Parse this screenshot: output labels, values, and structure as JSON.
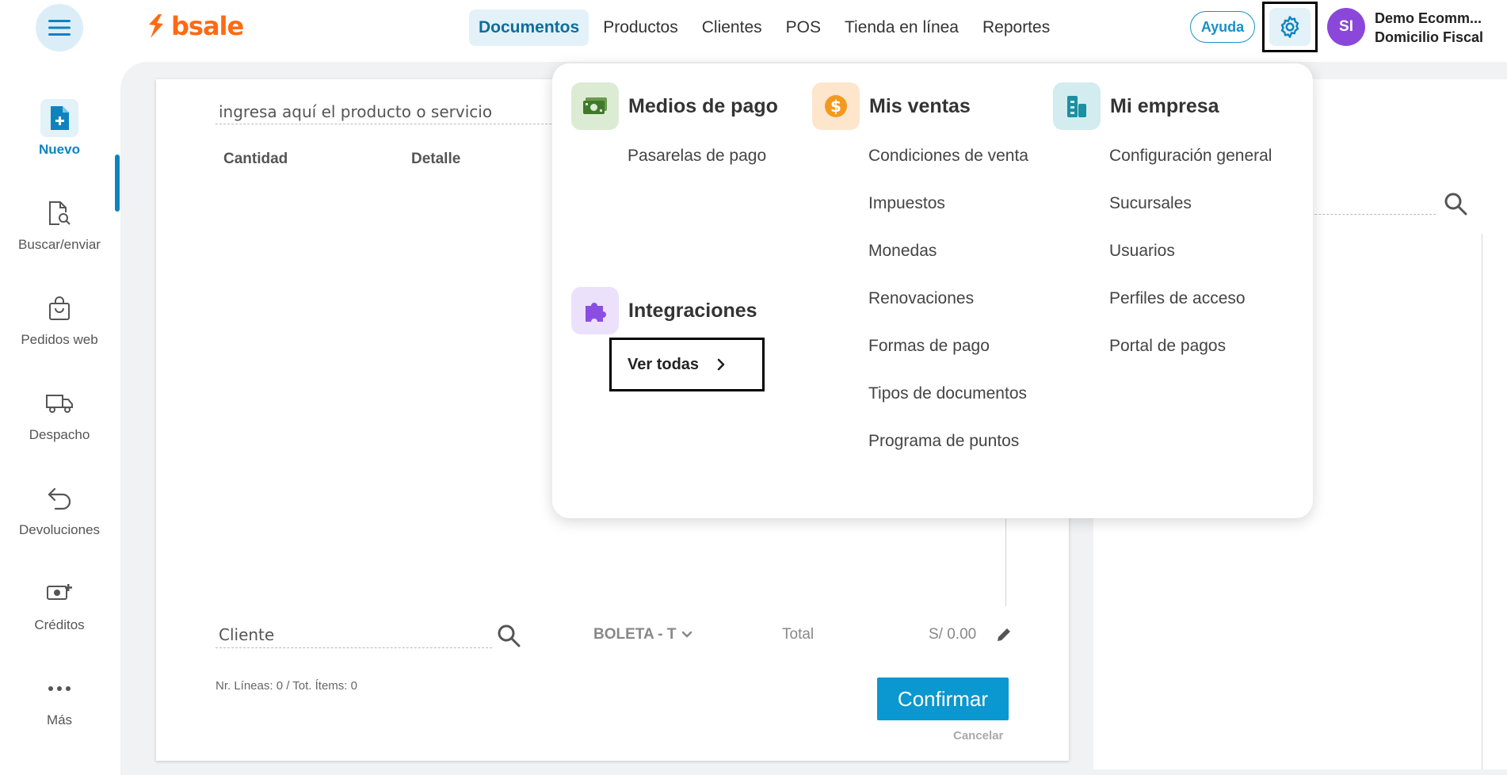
{
  "header": {
    "logo_text": "bsale",
    "nav": [
      "Documentos",
      "Productos",
      "Clientes",
      "POS",
      "Tienda en línea",
      "Reportes"
    ],
    "active_nav": "Documentos",
    "help_label": "Ayuda",
    "avatar_initials": "SI",
    "company_name": "Demo Ecomm...",
    "company_branch": "Domicilio Fiscal"
  },
  "sidebar": {
    "items": [
      {
        "label": "Nuevo",
        "icon": "new-document-icon"
      },
      {
        "label": "Buscar/enviar",
        "icon": "search-document-icon"
      },
      {
        "label": "Pedidos web",
        "icon": "shopping-bag-icon"
      },
      {
        "label": "Despacho",
        "icon": "truck-icon"
      },
      {
        "label": "Devoluciones",
        "icon": "return-arrow-icon"
      },
      {
        "label": "Créditos",
        "icon": "cash-plus-icon"
      },
      {
        "label": "Más",
        "icon": "more-dots-icon"
      }
    ]
  },
  "document": {
    "product_placeholder": "ingresa aquí el producto o servicio",
    "columns": [
      "Cantidad",
      "Detalle"
    ],
    "client_placeholder": "Cliente",
    "doc_type": "BOLETA - T",
    "total_label": "Total",
    "total_value": "S/ 0.00",
    "line_info": "Nr. Líneas: 0 / Tot. Ítems: 0",
    "confirm_label": "Confirmar",
    "cancel_label": "Cancelar"
  },
  "settings_menu": {
    "payment": {
      "title": "Medios de pago",
      "links": [
        "Pasarelas de pago"
      ]
    },
    "integrations": {
      "title": "Integraciones",
      "view_all": "Ver todas"
    },
    "sales": {
      "title": "Mis ventas",
      "links": [
        "Condiciones de venta",
        "Impuestos",
        "Monedas",
        "Renovaciones",
        "Formas de pago",
        "Tipos de documentos",
        "Programa de puntos"
      ]
    },
    "company": {
      "title": "Mi empresa",
      "links": [
        "Configuración general",
        "Sucursales",
        "Usuarios",
        "Perfiles de acceso",
        "Portal de pagos"
      ]
    }
  },
  "colors": {
    "brand_orange": "#ff6a13",
    "accent_blue": "#0e83c0",
    "confirm_blue": "#0b97cf",
    "avatar_purple": "#8b47d9"
  }
}
